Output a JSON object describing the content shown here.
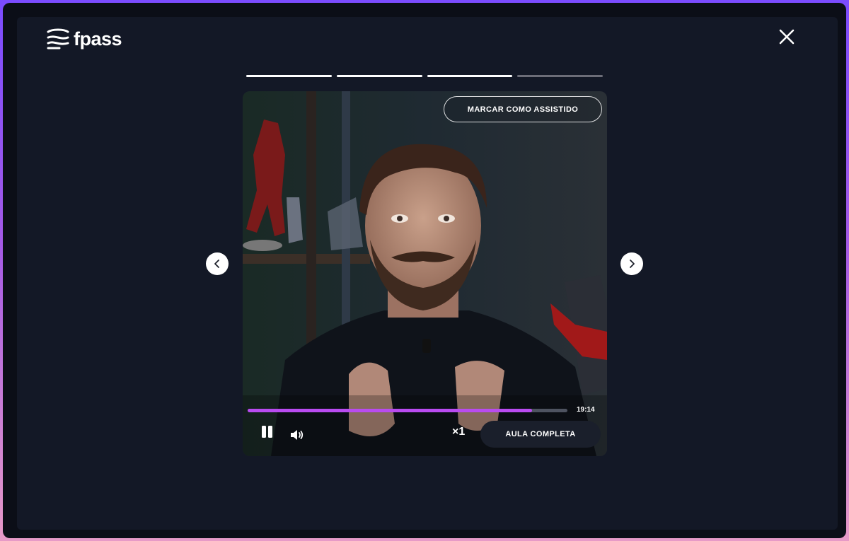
{
  "brand": {
    "logo_text": "fpass"
  },
  "stories": {
    "segments_total": 4,
    "segments_completed": 3
  },
  "video": {
    "mark_watched_label": "MARCAR COMO ASSISTIDO",
    "progress": 0.89,
    "time_remaining": "19:14",
    "speed_label": "×1",
    "full_lesson_label": "AULA COMPLETA",
    "accent_color": "#b94bf0"
  },
  "icons": {
    "close": "close-icon",
    "prev": "chevron-left-icon",
    "next": "chevron-right-icon",
    "pause": "pause-icon",
    "volume": "volume-icon"
  }
}
